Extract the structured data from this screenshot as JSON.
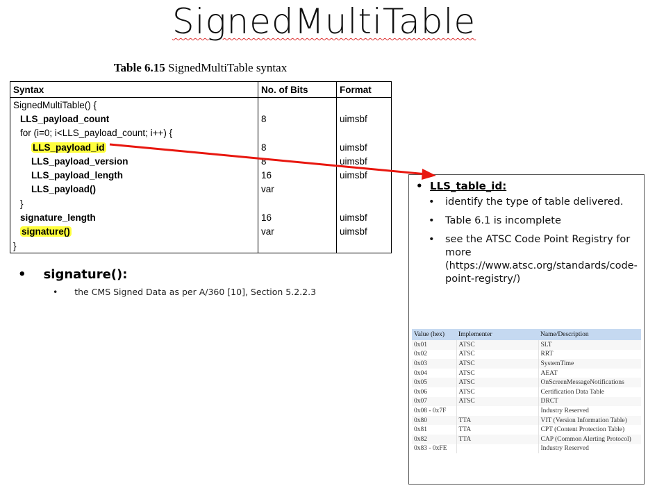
{
  "slide": {
    "title": "SignedMultiTable",
    "caption_bold": "Table 6.15",
    "caption_rest": " SignedMultiTable syntax"
  },
  "syntax_table": {
    "headers": [
      "Syntax",
      "No. of Bits",
      "Format"
    ],
    "rows": [
      {
        "syntax": "SignedMultiTable() {",
        "bits": "",
        "format": ""
      },
      {
        "syntax": "LLS_payload_count",
        "bits": "8",
        "format": "uimsbf"
      },
      {
        "syntax": "for (i=0; i<LLS_payload_count; i++) {",
        "bits": "",
        "format": ""
      },
      {
        "syntax": "LLS_payload_id",
        "bits": "8",
        "format": "uimsbf"
      },
      {
        "syntax": "LLS_payload_version",
        "bits": "8",
        "format": "uimsbf"
      },
      {
        "syntax": "LLS_payload_length",
        "bits": "16",
        "format": "uimsbf"
      },
      {
        "syntax": "LLS_payload()",
        "bits": "var",
        "format": ""
      },
      {
        "syntax": "}",
        "bits": "",
        "format": ""
      },
      {
        "syntax": "signature_length",
        "bits": "16",
        "format": "uimsbf"
      },
      {
        "syntax": "signature()",
        "bits": "var",
        "format": "uimsbf"
      },
      {
        "syntax": "}",
        "bits": "",
        "format": ""
      }
    ]
  },
  "signature_note": {
    "label": "signature():",
    "detail": "the CMS Signed Data as per A/360 [10], Section 5.2.2.3"
  },
  "lls_panel": {
    "heading": "LLS_table_id:",
    "bullets": [
      "identify the type of table delivered.",
      "Table 6.1 is incomplete",
      "see the ATSC Code Point Registry for more (https://www.atsc.org/standards/code-point-registry/)"
    ],
    "table_headers": [
      "Value (hex)",
      "Implementer",
      "Name/Description"
    ],
    "table_rows": [
      [
        "0x01",
        "ATSC",
        "SLT"
      ],
      [
        "0x02",
        "ATSC",
        "RRT"
      ],
      [
        "0x03",
        "ATSC",
        "SystemTime"
      ],
      [
        "0x04",
        "ATSC",
        "AEAT"
      ],
      [
        "0x05",
        "ATSC",
        "OnScreenMessageNotifications"
      ],
      [
        "0x06",
        "ATSC",
        "Certification Data Table"
      ],
      [
        "0x07",
        "ATSC",
        "DRCT"
      ],
      [
        "0x08 - 0x7F",
        "",
        "Industry Reserved"
      ],
      [
        "0x80",
        "TTA",
        "VIT (Version Information Table)"
      ],
      [
        "0x81",
        "TTA",
        "CPT (Content Protection Table)"
      ],
      [
        "0x82",
        "TTA",
        "CAP (Common Alerting Protocol)"
      ],
      [
        "0x83 - 0xFE",
        "",
        "Industry  Reserved"
      ]
    ]
  },
  "colors": {
    "highlight": "#ffff3c",
    "arrow": "#e8170f",
    "table_header": "#c5d9f1"
  }
}
